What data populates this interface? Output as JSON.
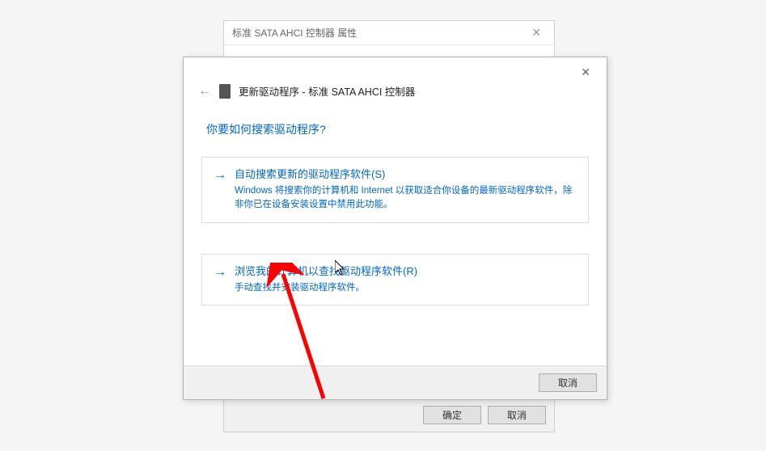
{
  "bgWindow": {
    "title": "标准 SATA AHCI 控制器 属性",
    "okButton": "确定",
    "cancelButton": "取消"
  },
  "mainWindow": {
    "headerTitle": "更新驱动程序 - 标准 SATA AHCI 控制器",
    "question": "你要如何搜索驱动程序?",
    "option1": {
      "title": "自动搜索更新的驱动程序软件(S)",
      "desc": "Windows 将搜索你的计算机和 Internet 以获取适合你设备的最新驱动程序软件，除非你已在设备安装设置中禁用此功能。"
    },
    "option2": {
      "title": "浏览我的计算机以查找驱动程序软件(R)",
      "desc": "手动查找并安装驱动程序软件。"
    },
    "cancelButton": "取消"
  }
}
